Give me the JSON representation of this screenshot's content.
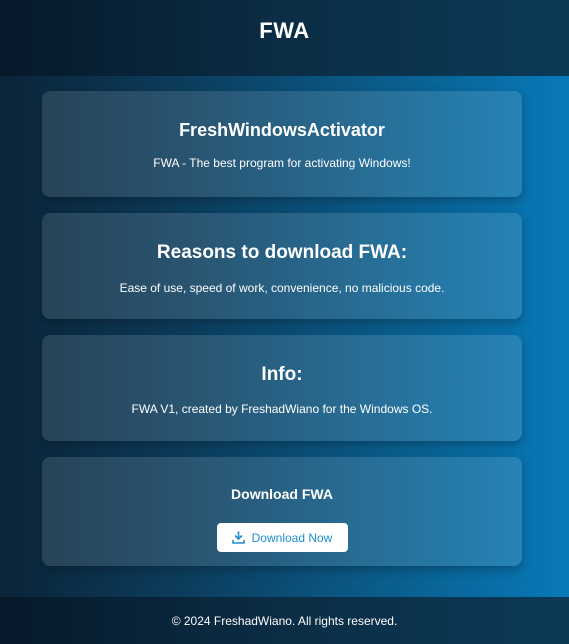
{
  "header": {
    "title": "FWA"
  },
  "cards": [
    {
      "title": "FreshWindowsActivator",
      "text": "FWA - The best program for activating Windows!"
    },
    {
      "title": "Reasons to download FWA:",
      "text": "Ease of use, speed of work, convenience, no malicious code."
    },
    {
      "title": "Info:",
      "text": "FWA V1, created by FreshadWiano for the Windows OS."
    }
  ],
  "download": {
    "title": "Download FWA",
    "button_label": "Download Now",
    "button_icon": "download-icon"
  },
  "footer": {
    "text": "© 2024 FreshadWiano. All rights reserved."
  },
  "colors": {
    "button_text": "#1f8fd0",
    "button_bg": "#ffffff",
    "header_bg": "#0b2d45"
  }
}
